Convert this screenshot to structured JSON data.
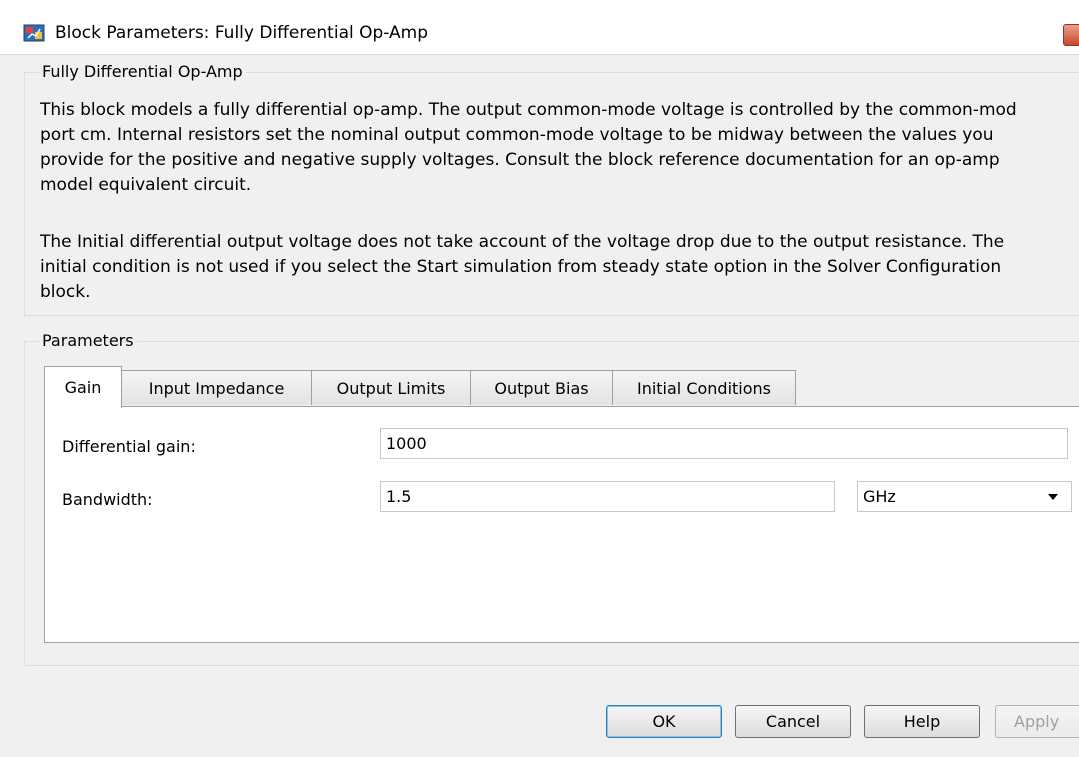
{
  "window": {
    "title": "Block Parameters: Fully Differential Op-Amp"
  },
  "description_group": {
    "title": "Fully Differential Op-Amp",
    "lines": [
      "This block models a fully differential op-amp. The output common-mode voltage is controlled by the common-mod",
      "port cm. Internal resistors set the nominal output common-mode voltage to be midway between the values you",
      "provide for the positive and negative supply voltages. Consult the block reference documentation for an op-amp",
      "model equivalent circuit.",
      "The Initial differential output voltage does not take account of the voltage drop due to the output resistance. The",
      "initial condition is not used if you select the Start simulation from steady state option in the Solver Configuration",
      "block."
    ]
  },
  "parameters_group": {
    "title": "Parameters",
    "tabs": [
      {
        "label": "Gain",
        "active": true
      },
      {
        "label": "Input Impedance",
        "active": false
      },
      {
        "label": "Output Limits",
        "active": false
      },
      {
        "label": "Output Bias",
        "active": false
      },
      {
        "label": "Initial Conditions",
        "active": false
      }
    ],
    "fields": {
      "differential_gain": {
        "label": "Differential gain:",
        "value": "1000"
      },
      "bandwidth": {
        "label": "Bandwidth:",
        "value": "1.5",
        "unit": "GHz"
      }
    }
  },
  "buttons": {
    "ok": "OK",
    "cancel": "Cancel",
    "help": "Help",
    "apply": "Apply"
  },
  "colors": {
    "dialog_background": "#f0f0f0",
    "group_border": "#d5dfe5",
    "tab_border": "#a0a0a0",
    "default_button_border": "#3c7fb1",
    "disabled_text": "#a0a0a0"
  },
  "icons": {
    "app": "simulink-block-icon",
    "close": "close-icon",
    "dropdown": "chevron-down-icon"
  }
}
